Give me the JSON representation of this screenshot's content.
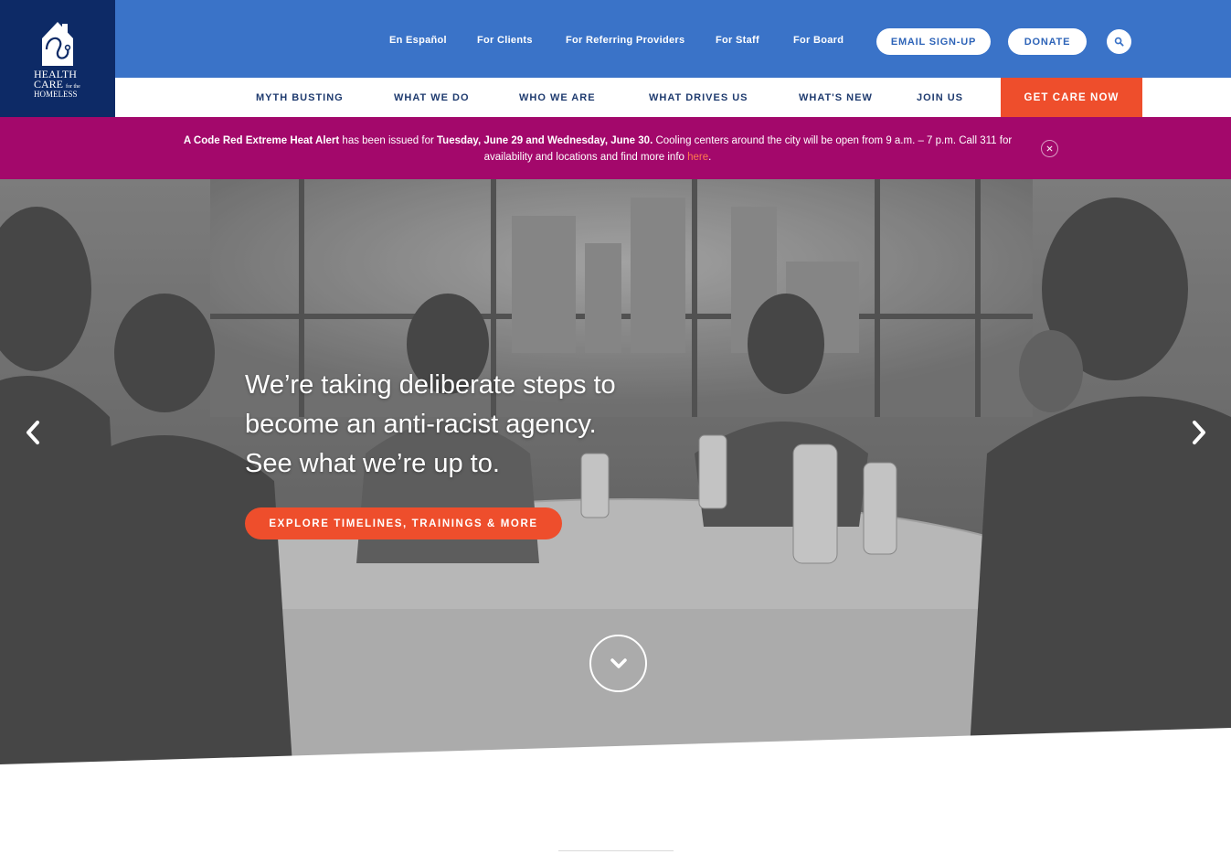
{
  "logo": {
    "line1": "HEALTH",
    "line2": "CARE",
    "small": "for the",
    "line3": "HOMELESS"
  },
  "utility_nav": {
    "links": [
      "En Español",
      "For Clients",
      "For Referring Providers",
      "For Staff",
      "For Board"
    ],
    "email_signup": "EMAIL SIGN-UP",
    "donate": "DONATE",
    "search_icon": "search-icon"
  },
  "main_nav": {
    "items": [
      "MYTH BUSTING",
      "WHAT WE DO",
      "WHO WE ARE",
      "WHAT DRIVES US",
      "WHAT'S NEW",
      "JOIN US"
    ],
    "cta": "GET CARE NOW"
  },
  "alert": {
    "bold_lead": "A Code Red Extreme Heat Alert",
    "text1": " has been issued for ",
    "bold_dates": "Tuesday, June 29 and Wednesday, June 30.",
    "text2": "  Cooling centers around the city will be open from 9 a.m. – 7 p.m. Call 311 for availability and locations and find more info ",
    "link": "here",
    "text3": ".",
    "close_icon": "close-icon"
  },
  "hero": {
    "headline_1": "We’re taking deliberate steps to",
    "headline_2": "become an anti-racist agency.",
    "headline_3": "See what we’re up to.",
    "cta": "EXPLORE TIMELINES, TRAININGS & MORE",
    "prev_icon": "chevron-left-icon",
    "next_icon": "chevron-right-icon",
    "scroll_icon": "chevron-down-icon"
  },
  "colors": {
    "navy": "#0d2a66",
    "blue": "#3a73c8",
    "orange": "#ee4e2c",
    "magenta": "#a3086b"
  }
}
